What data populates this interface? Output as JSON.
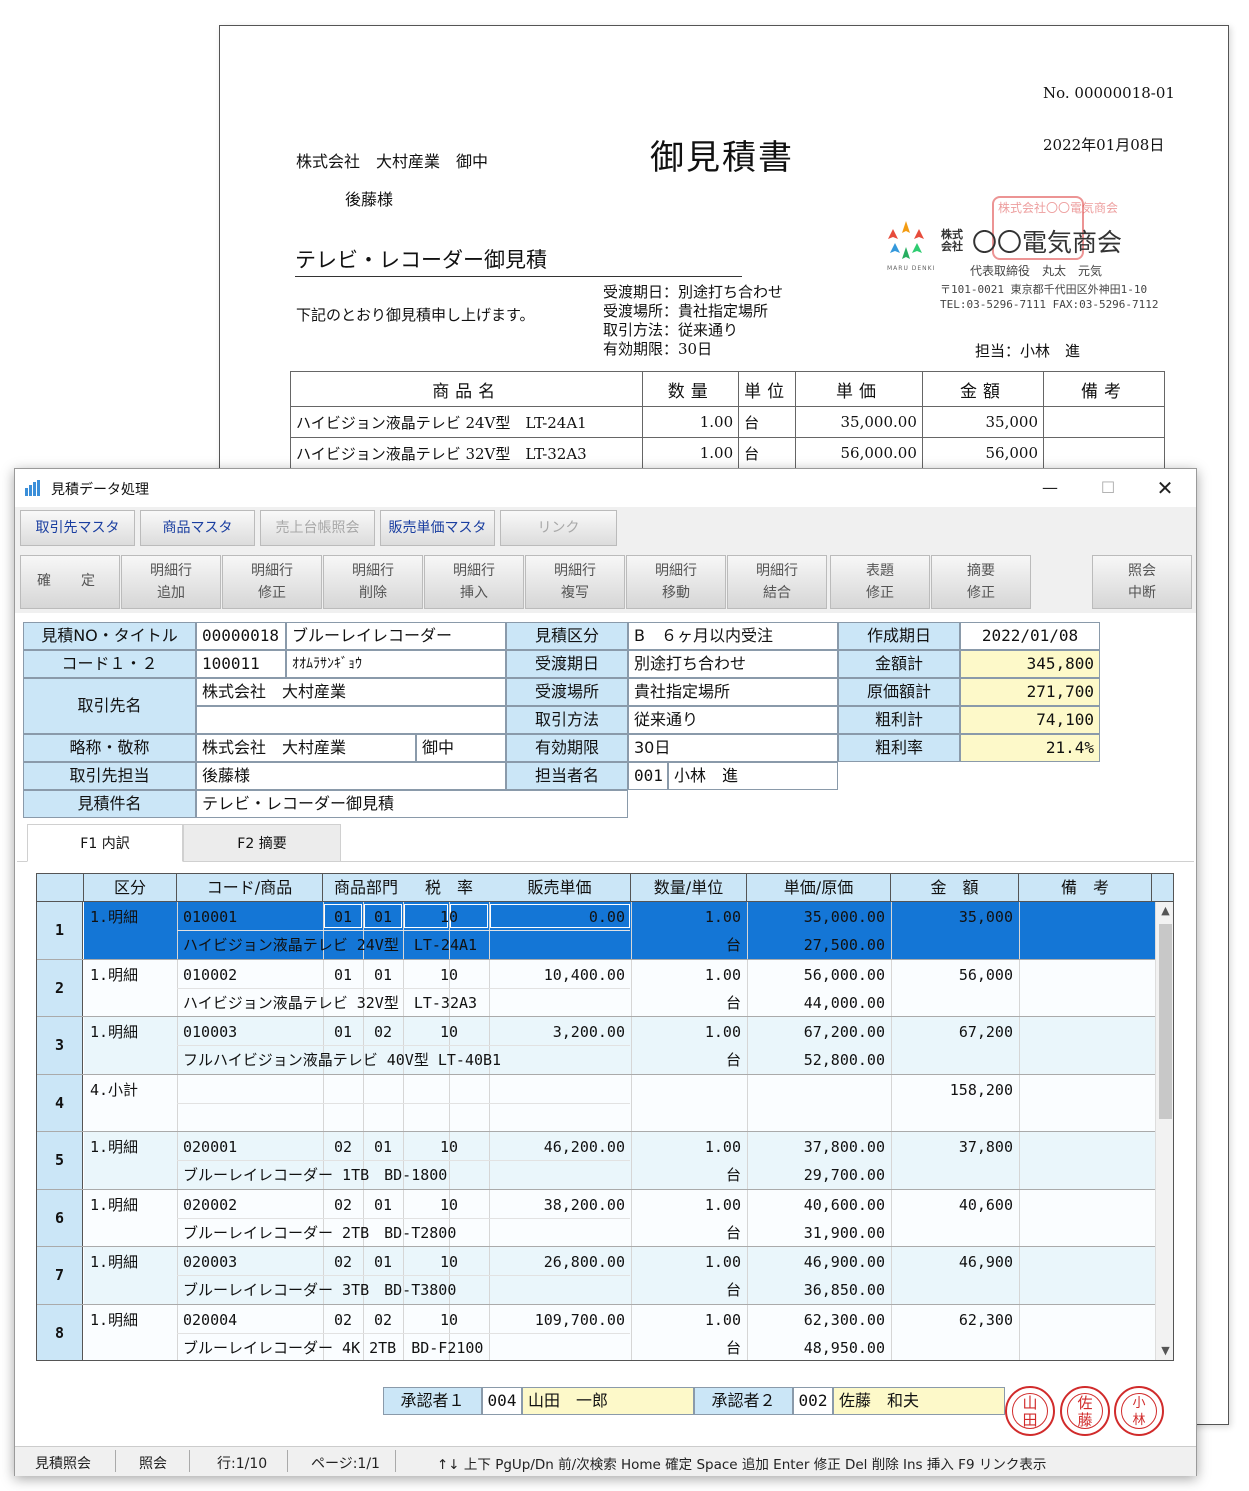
{
  "document": {
    "no": "No. 00000018-01",
    "date": "2022年01月08日",
    "title": "御見積書",
    "client": "株式会社　大村産業　御中",
    "person": "後藤様",
    "subject": "テレビ・レコーダー御見積",
    "lead": "下記のとおり御見積申し上げます。",
    "terms": [
      "受渡期日：別途打ち合わせ",
      "受渡場所：貴社指定場所",
      "取引方法：従来通り",
      "有効期限：30日"
    ],
    "company_kk": "株式\n会社",
    "company": "〇〇電気商会",
    "logo_caption": "MARU DENKI",
    "representative": "代表取締役　丸太　元気",
    "address": "〒101-0021 東京都千代田区外神田1-10",
    "tel": "TEL:03-5296-7111 FAX:03-5296-7112",
    "tanto": "担当：小林　進",
    "seal_text": "株式会社〇〇電気商会",
    "table_headers": [
      "商品名",
      "数量",
      "単位",
      "単価",
      "金額",
      "備考"
    ],
    "table_rows": [
      [
        "ハイビジョン液晶テレビ 24V型　LT-24A1",
        "1.00",
        "台",
        "35,000.00",
        "35,000",
        ""
      ],
      [
        "ハイビジョン液晶テレビ 32V型　LT-32A3",
        "1.00",
        "台",
        "56,000.00",
        "56,000",
        ""
      ]
    ]
  },
  "window": {
    "title": "見積データ処理",
    "min": "—",
    "max": "☐",
    "close": "✕"
  },
  "toolbar1": [
    "取引先マスタ",
    "商品マスタ",
    "売上台帳照会",
    "販売単価マスタ",
    "リンク"
  ],
  "toolbar2": [
    {
      "l1": "確　定",
      "l2": ""
    },
    {
      "l1": "明細行",
      "l2": "追加"
    },
    {
      "l1": "明細行",
      "l2": "修正"
    },
    {
      "l1": "明細行",
      "l2": "削除"
    },
    {
      "l1": "明細行",
      "l2": "挿入"
    },
    {
      "l1": "明細行",
      "l2": "複写"
    },
    {
      "l1": "明細行",
      "l2": "移動"
    },
    {
      "l1": "明細行",
      "l2": "結合"
    },
    {
      "l1": "表題",
      "l2": "修正"
    },
    {
      "l1": "摘要",
      "l2": "修正"
    },
    {
      "l1": "照会",
      "l2": "中断"
    }
  ],
  "header": {
    "labels": {
      "quote_no_title": "見積NO・タイトル",
      "code12": "コード１・２",
      "client_name": "取引先名",
      "short_honorific": "略称・敬称",
      "contact": "取引先担当",
      "subject": "見積件名",
      "category": "見積区分",
      "delivery_date": "受渡期日",
      "delivery_place": "受渡場所",
      "method": "取引方法",
      "validity": "有効期限",
      "staff": "担当者名",
      "created": "作成期日",
      "total": "金額計",
      "cost_total": "原価額計",
      "gross_profit": "粗利計",
      "gross_rate": "粗利率"
    },
    "values": {
      "quote_no": "00000018",
      "title": "ブルーレイレコーダー",
      "code1": "100011",
      "code2": "ｵｵﾑﾗｻﾝｷﾞｮｳ",
      "client_name1": "株式会社　大村産業",
      "client_name2": "",
      "short_name": "株式会社　大村産業",
      "honorific": "御中",
      "contact": "後藤様",
      "subject": "テレビ・レコーダー御見積",
      "category": "B　６ヶ月以内受注",
      "delivery_date": "別途打ち合わせ",
      "delivery_place": "貴社指定場所",
      "method": "従来通り",
      "validity": "30日",
      "staff_code": "001",
      "staff_name": "小林　進",
      "created": "2022/01/08",
      "total": "345,800",
      "cost_total": "271,700",
      "gross_profit": "74,100",
      "gross_rate": "21.4%"
    }
  },
  "tabs": [
    "F1 内訳",
    "F2 摘要"
  ],
  "grid": {
    "headers": [
      "区分",
      "コード/商品",
      "商品部門",
      "税　率",
      "販売単価",
      "数量/単位",
      "単価/原価",
      "金　額",
      "備　考"
    ],
    "rows": [
      {
        "no": "1",
        "kbn": "1.明細",
        "code": "010001",
        "d1": "01",
        "d2": "01",
        "tax": "10",
        "price": "0.00",
        "qty": "1.00",
        "unit_price": "35,000.00",
        "amount": "35,000",
        "name": "ハイビジョン液晶テレビ 24V型　LT-24A1",
        "unit": "台",
        "cost": "27,500.00"
      },
      {
        "no": "2",
        "kbn": "1.明細",
        "code": "010002",
        "d1": "01",
        "d2": "01",
        "tax": "10",
        "price": "10,400.00",
        "qty": "1.00",
        "unit_price": "56,000.00",
        "amount": "56,000",
        "name": "ハイビジョン液晶テレビ 32V型　LT-32A3",
        "unit": "台",
        "cost": "44,000.00"
      },
      {
        "no": "3",
        "kbn": "1.明細",
        "code": "010003",
        "d1": "01",
        "d2": "02",
        "tax": "10",
        "price": "3,200.00",
        "qty": "1.00",
        "unit_price": "67,200.00",
        "amount": "67,200",
        "name": "フルハイビジョン液晶テレビ 40V型 LT-40B1",
        "unit": "台",
        "cost": "52,800.00"
      },
      {
        "no": "4",
        "kbn": "4.小計",
        "code": "",
        "d1": "",
        "d2": "",
        "tax": "",
        "price": "",
        "qty": "",
        "unit_price": "",
        "amount": "158,200",
        "name": "",
        "unit": "",
        "cost": ""
      },
      {
        "no": "5",
        "kbn": "1.明細",
        "code": "020001",
        "d1": "02",
        "d2": "01",
        "tax": "10",
        "price": "46,200.00",
        "qty": "1.00",
        "unit_price": "37,800.00",
        "amount": "37,800",
        "name": "ブルーレイレコーダー 1TB　BD-1800",
        "unit": "台",
        "cost": "29,700.00"
      },
      {
        "no": "6",
        "kbn": "1.明細",
        "code": "020002",
        "d1": "02",
        "d2": "01",
        "tax": "10",
        "price": "38,200.00",
        "qty": "1.00",
        "unit_price": "40,600.00",
        "amount": "40,600",
        "name": "ブルーレイレコーダー 2TB　BD-T2800",
        "unit": "台",
        "cost": "31,900.00"
      },
      {
        "no": "7",
        "kbn": "1.明細",
        "code": "020003",
        "d1": "02",
        "d2": "01",
        "tax": "10",
        "price": "26,800.00",
        "qty": "1.00",
        "unit_price": "46,900.00",
        "amount": "46,900",
        "name": "ブルーレイレコーダー 3TB　BD-T3800",
        "unit": "台",
        "cost": "36,850.00"
      },
      {
        "no": "8",
        "kbn": "1.明細",
        "code": "020004",
        "d1": "02",
        "d2": "02",
        "tax": "10",
        "price": "109,700.00",
        "qty": "1.00",
        "unit_price": "62,300.00",
        "amount": "62,300",
        "name": "ブルーレイレコーダー 4K 2TB　BD-F2100",
        "unit": "台",
        "cost": "48,950.00"
      }
    ]
  },
  "approvers": {
    "label1": "承認者１",
    "code1": "004",
    "name1": "山田　一郎",
    "label2": "承認者２",
    "code2": "002",
    "name2": "佐藤　和夫",
    "hanko": [
      "山\n田",
      "佐\n藤",
      "小\n林"
    ]
  },
  "statusbar": {
    "mode": "見積照会",
    "state": "照会",
    "row": "行:1/10",
    "page": "ページ:1/1",
    "keys": "↑↓ 上下  PgUp/Dn 前/次検索  Home 確定  Space 追加  Enter 修正  Del 削除  Ins 挿入  F9 リンク表示"
  },
  "colors": {
    "label_bg": "#cbe6f7",
    "selected_row": "#1476d6",
    "sum_bg": "#fdf9c9",
    "hanko_red": "#d12b2b",
    "toolbar_text": "#1a3ea0"
  }
}
